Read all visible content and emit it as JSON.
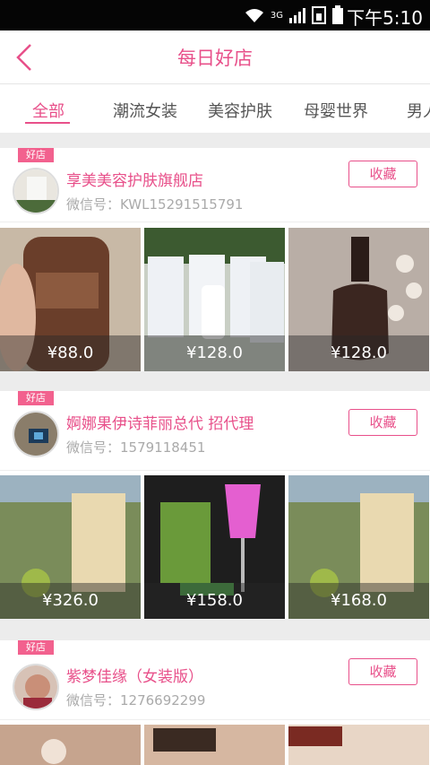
{
  "status": {
    "network": "3G",
    "time": "下午5:10"
  },
  "nav": {
    "title": "每日好店"
  },
  "tabs": [
    "全部",
    "潮流女装",
    "美容护肤",
    "母婴世界",
    "男人"
  ],
  "badge_label": "好店",
  "fav_label": "收藏",
  "shops": [
    {
      "name": "享美美容护肤旗舰店",
      "wechat": "微信号：KWL15291515791",
      "prices": [
        "¥88.0",
        "¥128.0",
        "¥128.0"
      ]
    },
    {
      "name": "婀娜果伊诗菲丽总代 招代理",
      "wechat": "微信号：1579118451",
      "prices": [
        "¥326.0",
        "¥158.0",
        "¥168.0"
      ]
    },
    {
      "name": "紫梦佳缘（女装版）",
      "wechat": "微信号：1276692299",
      "prices": [
        "",
        "",
        ""
      ]
    }
  ],
  "colors": {
    "accent": "#e8508a",
    "badge": "#f2618e"
  }
}
